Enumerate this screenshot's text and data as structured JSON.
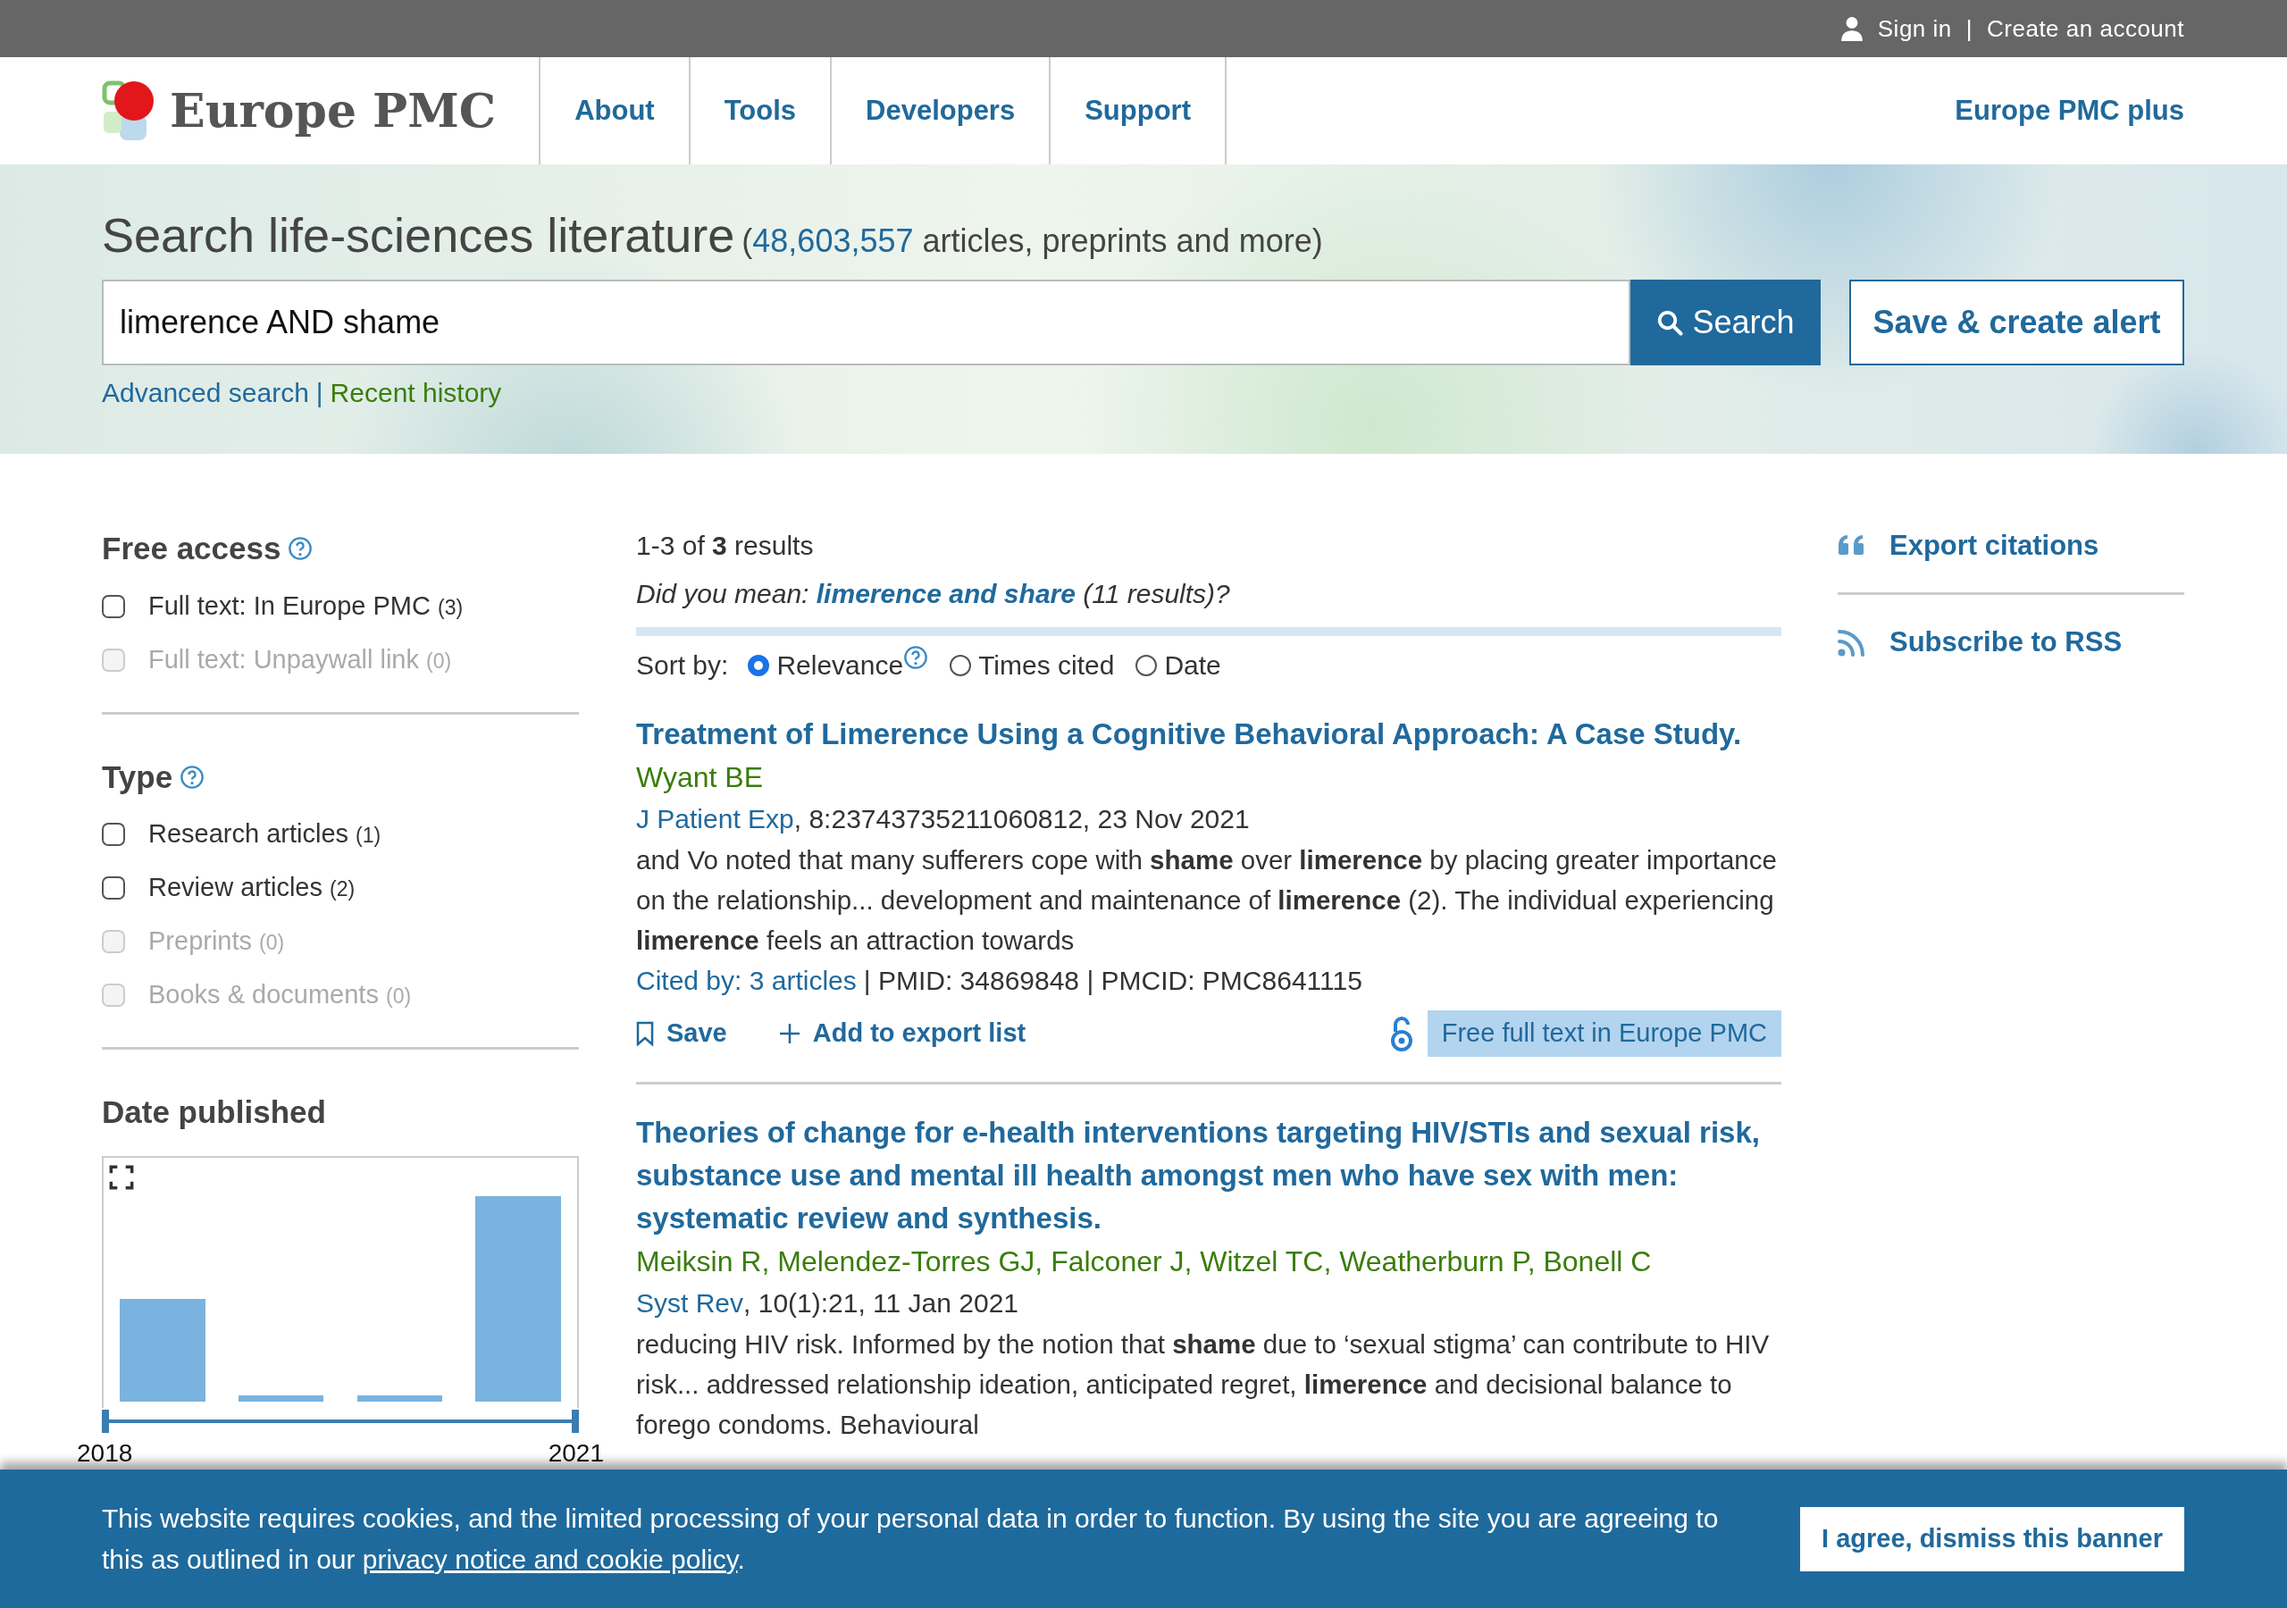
{
  "top_bar": {
    "sign_in": "Sign in",
    "separator": "|",
    "create_account": "Create an account"
  },
  "header": {
    "logo_text": "Europe PMC",
    "nav": [
      "About",
      "Tools",
      "Developers",
      "Support"
    ],
    "plus_link": "Europe PMC plus"
  },
  "search": {
    "heading": "Search life-sciences literature",
    "stats_open": "(",
    "stats_count": "48,603,557",
    "stats_rest": "articles, preprints and more)",
    "query": "limerence AND shame",
    "search_button": "Search",
    "alert_button": "Save & create alert",
    "advanced_link": "Advanced search",
    "separator": "|",
    "history_link": "Recent history"
  },
  "filters": [
    {
      "title": "Free access",
      "help": true,
      "options": [
        {
          "label": "Full text: In Europe PMC",
          "count": "(3)",
          "checked": false,
          "disabled": false
        },
        {
          "label": "Full text: Unpaywall link",
          "count": "(0)",
          "checked": false,
          "disabled": true
        }
      ]
    },
    {
      "title": "Type",
      "help": true,
      "options": [
        {
          "label": "Research articles",
          "count": "(1)",
          "checked": false,
          "disabled": false
        },
        {
          "label": "Review articles",
          "count": "(2)",
          "checked": false,
          "disabled": false
        },
        {
          "label": "Preprints",
          "count": "(0)",
          "checked": false,
          "disabled": true
        },
        {
          "label": "Books & documents",
          "count": "(0)",
          "checked": false,
          "disabled": true
        }
      ]
    },
    {
      "title": "Date published",
      "help": false,
      "chart": {
        "start_label": "2018",
        "end_label": "2021",
        "level": 1
      }
    }
  ],
  "results": {
    "summary": "1-3 of **3** results",
    "did_you_mean": {
      "prefix": "Did you mean:",
      "link": "limerence and share",
      "suffix": "(11 results)?"
    },
    "sort": {
      "label": "Sort by:",
      "options": [
        {
          "label": "Relevance",
          "selected": true,
          "help": true
        },
        {
          "label": "Times cited",
          "selected": false,
          "help": false
        },
        {
          "label": "Date",
          "selected": false,
          "help": false
        }
      ]
    },
    "articles": [
      {
        "title": "Treatment of **Limerence** Using a Cognitive Behavioral Approach: A Case Study.",
        "authors": "Wyant BE",
        "journal": "J Patient Exp",
        "citation": ", 8:23743735211060812, 23 Nov 2021",
        "snippet": "and Vo noted that many sufferers cope with **shame** over **limerence** by placing greater importance on the relationship... development and maintenance of **limerence** (2). The individual experiencing **limerence** feels an attraction towards",
        "cited_by": "Cited by: 3 articles",
        "ids": "| PMID: 34869848 | PMCID: PMC8641115",
        "save": "Save",
        "export": "Add to export list",
        "free_text": "Free full text in Europe PMC"
      },
      {
        "title": "Theories of change for e-health interventions targeting HIV/STIs and sexual risk, substance use and mental ill health amongst men who have sex with men: systematic review and synthesis.",
        "authors": "Meiksin R, Melendez-Torres GJ, Falconer J, Witzel TC, Weatherburn P, Bonell C",
        "journal": "Syst Rev",
        "citation": ", 10(1):21, 11 Jan 2021",
        "snippet": "reducing HIV risk. Informed by the notion that **shame** due to ‘sexual stigma’ can contribute to HIV risk... addressed relationship ideation, anticipated regret, **limerence** and decisional balance to forego condoms. Behavioural"
      }
    ]
  },
  "side_links": [
    {
      "kind": "quote",
      "label": "Export citations"
    },
    {
      "kind": "rss",
      "label": "Subscribe to RSS"
    }
  ],
  "cookie_banner": {
    "text": "This website requires cookies, and the limited processing of your personal data in order to function. By using the site you are agreeing to this as outlined in our",
    "link": "privacy notice and cookie policy",
    "end": ".",
    "button": "I agree, dismiss this banner"
  }
}
